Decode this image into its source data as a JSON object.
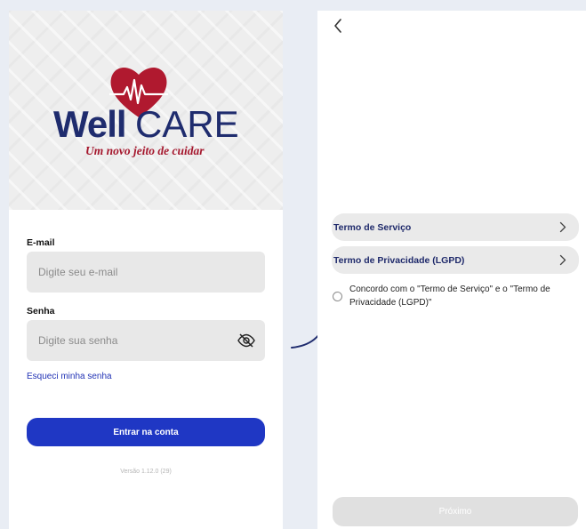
{
  "login": {
    "brand": {
      "well": "Well",
      "care": "CARE",
      "tagline": "Um novo jeito de cuidar"
    },
    "email_label": "E-mail",
    "email_placeholder": "Digite seu e-mail",
    "password_label": "Senha",
    "password_placeholder": "Digite sua senha",
    "forgot_password": "Esqueci minha senha",
    "submit_label": "Entrar na conta",
    "version": "Versão 1.12.0 (29)"
  },
  "terms": {
    "back_icon": "chevron-left-icon",
    "items": [
      {
        "label": "Termo de Serviço"
      },
      {
        "label": "Termo de Privacidade (LGPD)"
      }
    ],
    "agree_text": "Concordo com o \"Termo de Serviço\" e o \"Termo de Privacidade (LGPD)\"",
    "agree_checked": false,
    "next_label": "Próximo"
  },
  "colors": {
    "brand_navy": "#1f2c6e",
    "brand_red": "#a5172d",
    "primary_button": "#1f37c4",
    "link": "#2233b5",
    "disabled_button": "#e0e0e0",
    "arrow": "#1f2c6e"
  }
}
